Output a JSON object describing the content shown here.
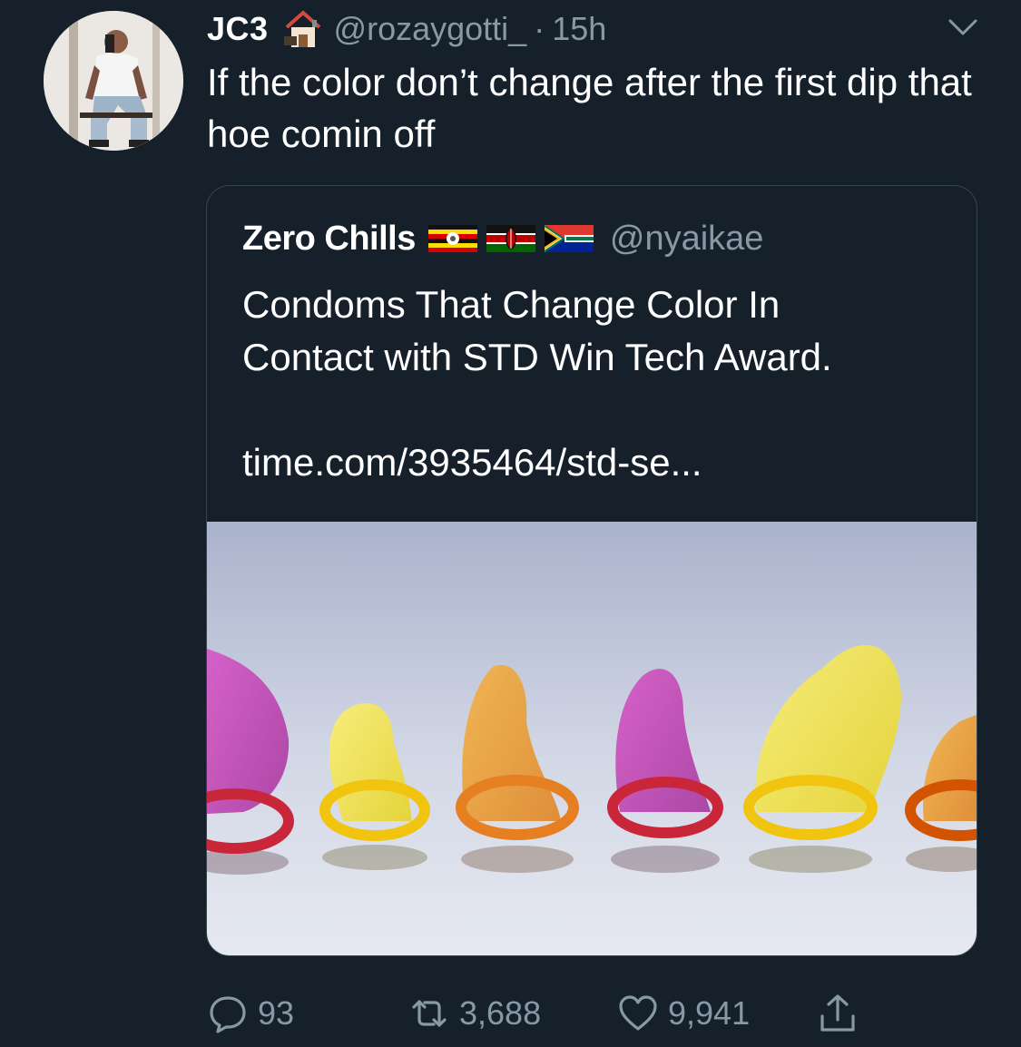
{
  "tweet": {
    "author_name": "JC3",
    "author_handle": "@rozaygotti_",
    "separator": "·",
    "timestamp": "15h",
    "text": "If the color don’t change after the first dip that hoe comin off"
  },
  "quoted_tweet": {
    "author_name": "Zero Chills",
    "flags": [
      "uganda-flag",
      "kenya-flag",
      "south-africa-flag"
    ],
    "author_handle": "@nyaikae",
    "text": "Condoms That Change Color In\nContact with STD Win Tech Award.",
    "link": "time.com/3935464/std-se..."
  },
  "actions": {
    "replies": "93",
    "retweets": "3,688",
    "likes": "9,941"
  },
  "icons": {
    "house": "house-emoji-icon",
    "menu": "chevron-down-icon",
    "reply": "reply-icon",
    "retweet": "retweet-icon",
    "like": "heart-icon",
    "share": "share-icon"
  },
  "colors": {
    "background": "#15202b",
    "text": "#ffffff",
    "secondary_text": "#8899a6",
    "border": "#38444d"
  }
}
